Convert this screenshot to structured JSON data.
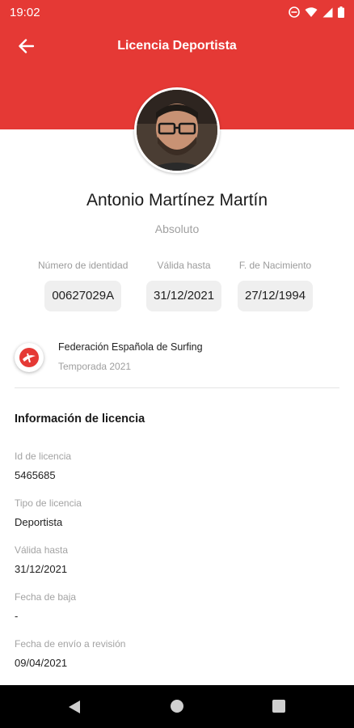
{
  "status_bar": {
    "time": "19:02"
  },
  "header": {
    "title": "Licencia Deportista"
  },
  "profile": {
    "name": "Antonio Martínez Martín",
    "category": "Absoluto"
  },
  "identity": [
    {
      "label": "Número de identidad",
      "value": "00627029A"
    },
    {
      "label": "Válida hasta",
      "value": "31/12/2021"
    },
    {
      "label": "F. de Nacimiento",
      "value": "27/12/1994"
    }
  ],
  "federation": {
    "name": "Federación Española de Surfing",
    "season": "Temporada 2021"
  },
  "license_info": {
    "title": "Información de licencia",
    "fields": [
      {
        "label": "Id de licencia",
        "value": "5465685"
      },
      {
        "label": "Tipo de licencia",
        "value": "Deportista"
      },
      {
        "label": "Válida hasta",
        "value": "31/12/2021"
      },
      {
        "label": "Fecha de baja",
        "value": "-"
      },
      {
        "label": "Fecha de envío a revisión",
        "value": "09/04/2021"
      }
    ]
  },
  "colors": {
    "primary": "#e53935",
    "navbar": "#000000"
  },
  "icons": [
    "back-arrow-icon",
    "dnd-icon",
    "wifi-icon",
    "signal-icon",
    "battery-icon",
    "federation-logo-icon",
    "nav-back-icon",
    "nav-home-icon",
    "nav-recents-icon"
  ]
}
